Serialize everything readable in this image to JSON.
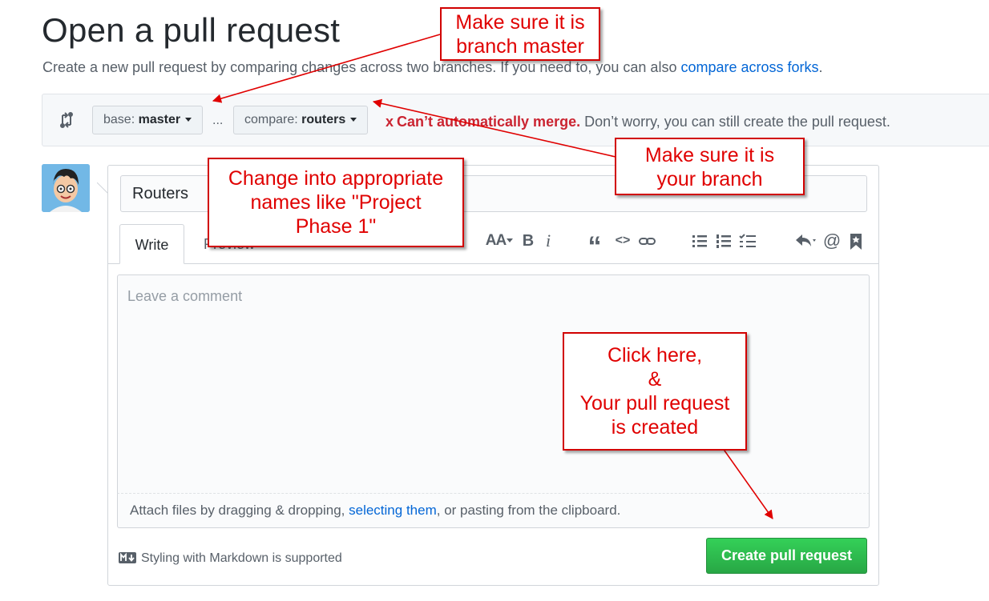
{
  "header": {
    "title": "Open a pull request",
    "subtitle_prefix": "Create a new pull request by comparing changes across two branches. If you need to, you can also ",
    "subtitle_link": "compare across forks",
    "subtitle_suffix": "."
  },
  "range": {
    "base_prefix": "base: ",
    "base_branch": "master",
    "separator": "...",
    "compare_prefix": "compare: ",
    "compare_branch": "routers",
    "merge_icon": "x",
    "merge_warning": "Can’t automatically merge.",
    "merge_message": " Don’t worry, you can still create the pull request."
  },
  "form": {
    "title_value": "Routers",
    "tabs": [
      {
        "label": "Write"
      },
      {
        "label": "Preview"
      }
    ],
    "toolbar": {
      "heading_glyph": "AA",
      "bold_glyph": "B",
      "italic_glyph": "i",
      "quote_glyph": "“",
      "code_glyph": "<>"
    },
    "comment_placeholder": "Leave a comment",
    "attach_prefix": "Attach files by dragging & dropping, ",
    "attach_link": "selecting them",
    "attach_suffix": ", or pasting from the clipboard.",
    "markdown_note": "Styling with Markdown is supported",
    "submit_label": "Create pull request"
  },
  "annotations": {
    "base_note": "Make sure it is\nbranch master",
    "compare_note": "Make sure it is\nyour branch",
    "title_note": "Change into appropriate\nnames like \"Project\nPhase 1\"",
    "submit_note": "Click here,\n&\nYour pull request\nis created"
  },
  "colors": {
    "accent_link": "#0366d6",
    "error_red": "#cb2431",
    "button_green": "#28a745",
    "annotation_red": "#e00000"
  }
}
